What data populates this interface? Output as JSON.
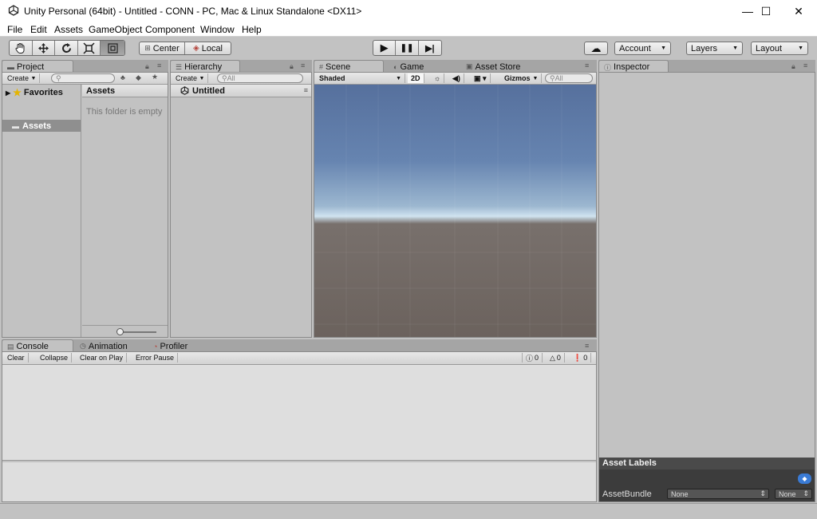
{
  "window": {
    "title": "Unity Personal (64bit) - Untitled - CONN - PC, Mac & Linux Standalone <DX11>",
    "minimize": "—",
    "maximize": "☐",
    "close": "✕"
  },
  "menu": [
    "File",
    "Edit",
    "Assets",
    "GameObject",
    "Component",
    "Window",
    "Help"
  ],
  "toolbar": {
    "tools": [
      "hand-icon",
      "move-icon",
      "rotate-icon",
      "scale-icon",
      "rect-icon"
    ],
    "pivot": "Center",
    "space": "Local",
    "play": "▶",
    "pause": "❚❚",
    "step": "▶|",
    "cloud": "☁",
    "account": "Account",
    "layers": "Layers",
    "layout": "Layout"
  },
  "project": {
    "tab": "Project",
    "create": "Create",
    "favorites": "Favorites",
    "assets_tree": "Assets",
    "assets_header": "Assets",
    "empty_msg": "This folder is empty"
  },
  "hierarchy": {
    "tab": "Hierarchy",
    "create": "Create",
    "search_placeholder": "All",
    "scene_name": "Untitled"
  },
  "scene": {
    "tabs": [
      "Scene",
      "Game",
      "Asset Store"
    ],
    "shading": "Shaded",
    "mode2d": "2D",
    "gizmos": "Gizmos",
    "search_placeholder": "All"
  },
  "inspector": {
    "tab": "Inspector",
    "asset_labels": "Asset Labels",
    "assetbundle_label": "AssetBundle",
    "assetbundle_value": "None",
    "variant_value": "None"
  },
  "console": {
    "tabs": [
      "Console",
      "Animation",
      "Profiler"
    ],
    "buttons": [
      "Clear",
      "Collapse",
      "Clear on Play",
      "Error Pause"
    ],
    "info_count": "0",
    "warn_count": "0",
    "error_count": "0"
  },
  "colors": {
    "sky_top": "#5873a0",
    "horizon": "#cfe3f0",
    "ground": "#6b625d",
    "panel": "#c2c2c2",
    "dark_bar": "#3c3c3c",
    "selection": "#8f8f8f"
  }
}
